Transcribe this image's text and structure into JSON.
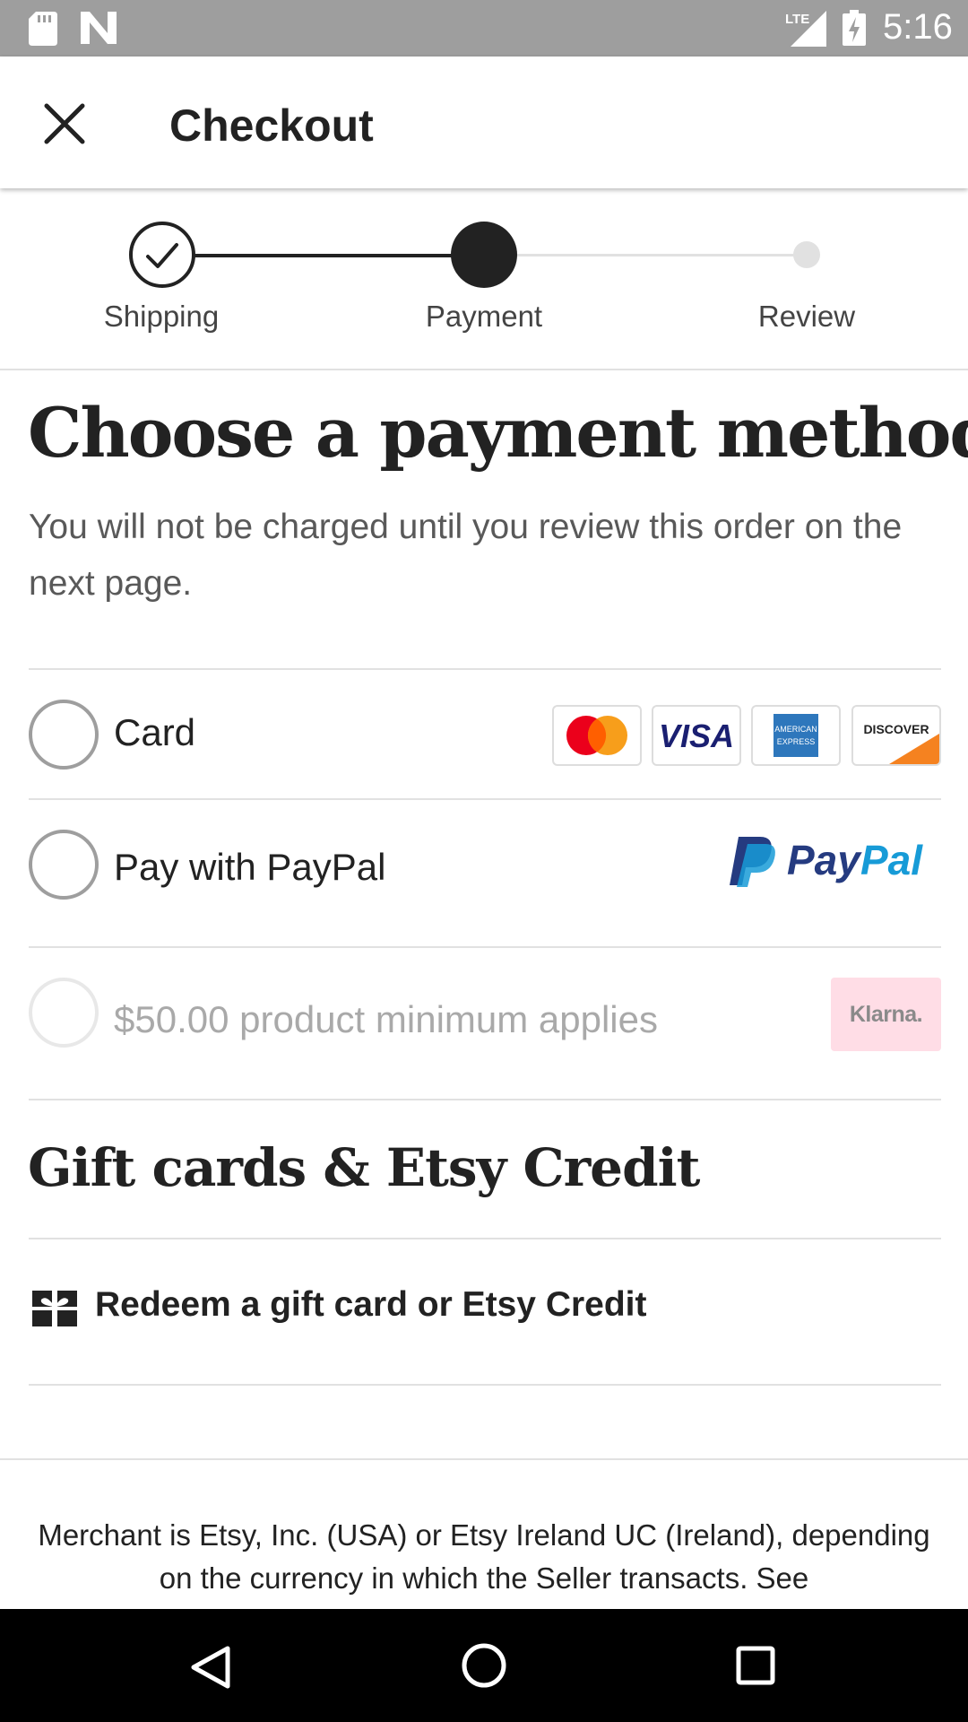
{
  "status_bar": {
    "time": "5:16",
    "network": "LTE",
    "icons": [
      "sd-card-icon",
      "n-logo-icon",
      "lte-signal-icon",
      "battery-charging-icon"
    ]
  },
  "header": {
    "title": "Checkout",
    "close_icon": "close-icon"
  },
  "stepper": {
    "steps": [
      {
        "label": "Shipping",
        "state": "completed"
      },
      {
        "label": "Payment",
        "state": "current"
      },
      {
        "label": "Review",
        "state": "upcoming"
      }
    ]
  },
  "main": {
    "heading": "Choose a payment method",
    "subtitle": "You will not be charged until you review this order on the next page."
  },
  "payment_options": [
    {
      "label": "Card",
      "selected": false,
      "enabled": true,
      "logos": [
        "Mastercard",
        "VISA",
        "American Express",
        "DISCOVER"
      ]
    },
    {
      "label": "Pay with PayPal",
      "selected": false,
      "enabled": true,
      "logo": "PayPal"
    },
    {
      "label": "$50.00 product minimum applies",
      "selected": false,
      "enabled": false,
      "logo": "Klarna."
    }
  ],
  "gift_section": {
    "title": "Gift cards & Etsy Credit",
    "redeem_label": "Redeem a gift card or Etsy Credit",
    "redeem_icon": "gift-icon"
  },
  "footer": {
    "merchant_text": "Merchant is Etsy, Inc. (USA) or Etsy Ireland UC (Ireland), depending on the currency in which the Seller transacts. See"
  },
  "nav_bar": {
    "icons": [
      "back-icon",
      "home-icon",
      "recents-icon"
    ]
  },
  "colors": {
    "status_bar": "#9e9e9e",
    "text": "#222222",
    "muted": "#595959",
    "divider": "#e1e1e1",
    "paypal_dark": "#253b80",
    "paypal_light": "#179bd7",
    "klarna_pink": "#ffb3c7"
  }
}
